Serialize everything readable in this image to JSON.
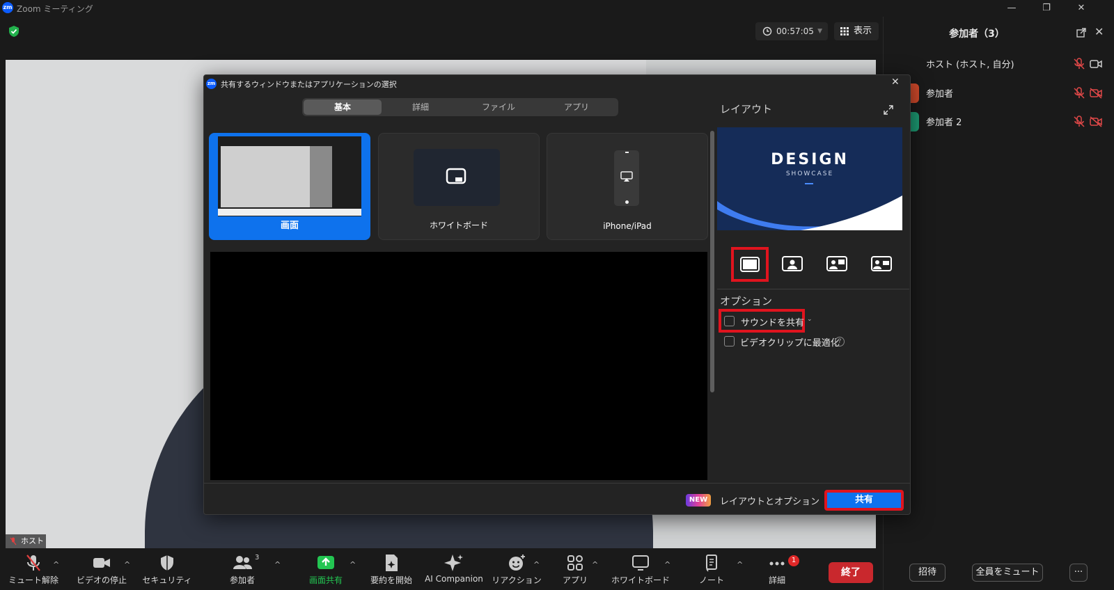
{
  "window": {
    "title": "Zoom ミーティング",
    "logo": "zm",
    "minimize": "—",
    "restore": "❐",
    "close": "✕"
  },
  "header": {
    "timer": "00:57:05",
    "view_label": "表示"
  },
  "video": {
    "name_tag": "ホスト"
  },
  "participants": {
    "title": "参加者（3）",
    "rows": [
      {
        "name": "ホスト (ホスト, 自分)"
      },
      {
        "name": "参加者"
      },
      {
        "name": "参加者 2"
      }
    ],
    "invite": "招待",
    "mute_all": "全員をミュート",
    "more": "···"
  },
  "dialog": {
    "logo": "zm",
    "title": "共有するウィンドウまたはアプリケーションの選択",
    "close": "✕",
    "tabs": [
      "基本",
      "詳細",
      "ファイル",
      "アプリ"
    ],
    "sources": [
      {
        "label": "画面"
      },
      {
        "label": "ホワイトボード"
      },
      {
        "label": "iPhone/iPad"
      }
    ],
    "layout_title": "レイアウト",
    "thumbnail": {
      "line1": "DESIGN",
      "line2": "SHOWCASE"
    },
    "options_title": "オプション",
    "options": [
      {
        "label": "サウンドを共有"
      },
      {
        "label": "ビデオクリップに最適化"
      }
    ],
    "help": "?",
    "new_badge": "NEW",
    "layout_options": "レイアウトとオプション",
    "share_button": "共有"
  },
  "toolbar": {
    "items": [
      {
        "label": "ミュート解除"
      },
      {
        "label": "ビデオの停止"
      },
      {
        "label": "セキュリティ"
      },
      {
        "label": "参加者",
        "count": "3"
      },
      {
        "label": "画面共有"
      },
      {
        "label": "要約を開始"
      },
      {
        "label": "AI Companion"
      },
      {
        "label": "リアクション"
      },
      {
        "label": "アプリ"
      },
      {
        "label": "ホワイトボード"
      },
      {
        "label": "ノート"
      },
      {
        "label": "詳細",
        "badge": "1"
      }
    ],
    "end": "終了"
  },
  "colors": {
    "accent": "#0e72ed",
    "end": "#c9282d",
    "highlight": "#e0141e",
    "share_green": "#23c552"
  }
}
